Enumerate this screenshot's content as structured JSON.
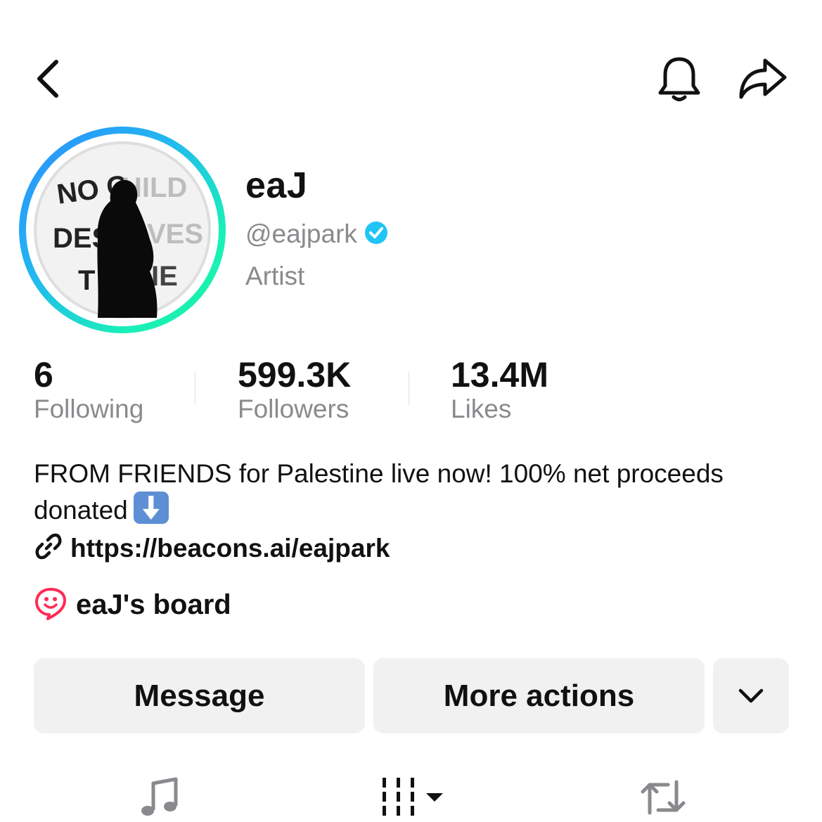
{
  "profile": {
    "display_name": "eaJ",
    "handle": "@eajpark",
    "category": "Artist",
    "avatar_text": "NO CHILD DESERVES TO DIE"
  },
  "stats": [
    {
      "value": "6",
      "label": "Following"
    },
    {
      "value": "599.3K",
      "label": "Followers"
    },
    {
      "value": "13.4M",
      "label": "Likes"
    }
  ],
  "bio": {
    "text": "FROM FRIENDS for Palestine live now! 100% net proceeds donated",
    "emoji": "down-arrow-emoji"
  },
  "link": {
    "url": "https://beacons.ai/eajpark",
    "icon": "link-icon"
  },
  "board": {
    "label": "eaJ's board",
    "icon": "board-icon"
  },
  "actions": {
    "message_label": "Message",
    "more_label": "More actions",
    "dropdown_icon": "chevron-down-icon"
  },
  "nav": {
    "back_icon": "back-icon",
    "bell_icon": "bell-icon",
    "share_icon": "share-icon"
  },
  "tabs": [
    {
      "icon": "music-note-icon"
    },
    {
      "icon": "playlist-grid-icon"
    },
    {
      "icon": "repost-icon"
    }
  ],
  "colors": {
    "verified": "#20C5F5",
    "ring_start": "#2B8CFF",
    "ring_end": "#1BF3A0",
    "board_icon": "#FE2C55",
    "secondary_text": "#8A8A8E",
    "button_bg": "#F1F1F2"
  }
}
